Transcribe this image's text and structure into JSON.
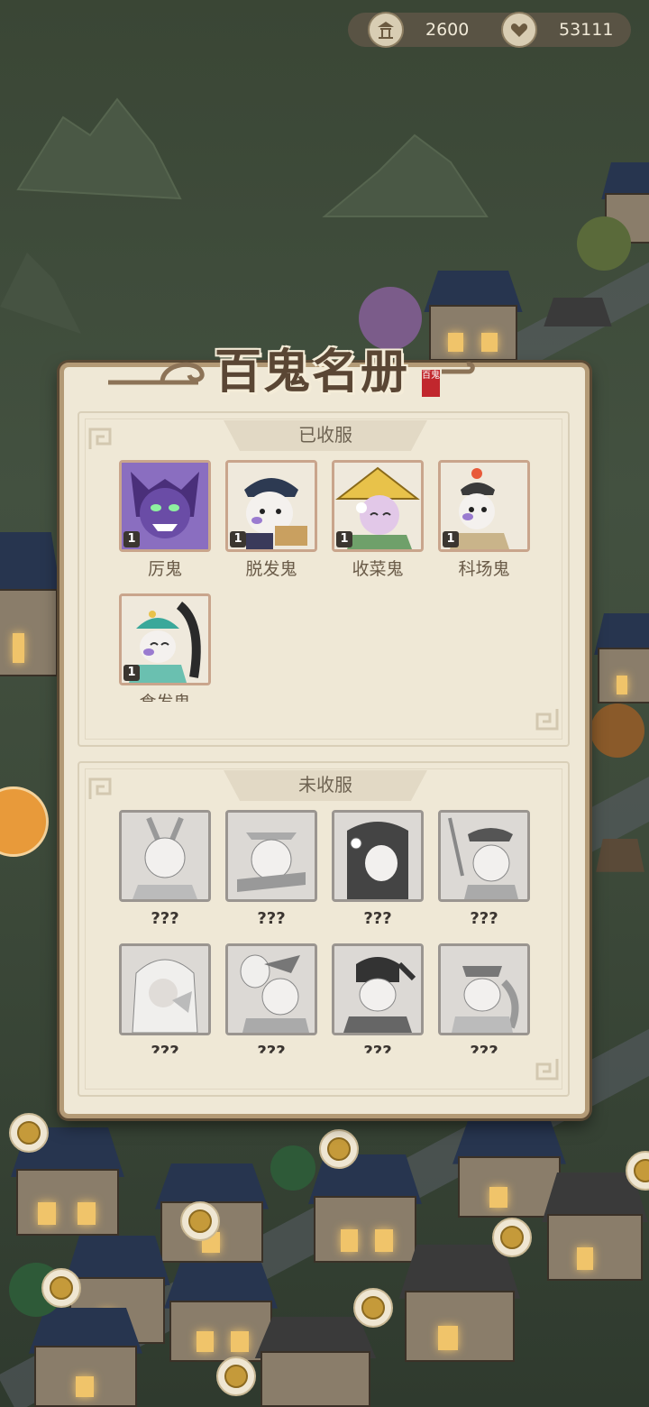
{
  "resources": [
    {
      "icon": "pavilion-icon",
      "value": "2600"
    },
    {
      "icon": "heart-icon",
      "value": "53111"
    }
  ],
  "panel": {
    "title": "百鬼名册",
    "seal_text": "百鬼"
  },
  "collected": {
    "header": "已收服",
    "ghosts": [
      {
        "name": "厉鬼",
        "level": "1"
      },
      {
        "name": "脱发鬼",
        "level": "1"
      },
      {
        "name": "收菜鬼",
        "level": "1"
      },
      {
        "name": "科场鬼",
        "level": "1"
      },
      {
        "name": "食发鬼",
        "level": "1"
      }
    ]
  },
  "uncollected": {
    "header": "未收服",
    "ghosts": [
      {
        "name": "???"
      },
      {
        "name": "???"
      },
      {
        "name": "???"
      },
      {
        "name": "???"
      },
      {
        "name": "???"
      },
      {
        "name": "???"
      },
      {
        "name": "???"
      },
      {
        "name": "???"
      }
    ]
  },
  "colors": {
    "panel_bg": "#efe8d6",
    "frame": "#b39a76",
    "title": "#5a4634"
  }
}
